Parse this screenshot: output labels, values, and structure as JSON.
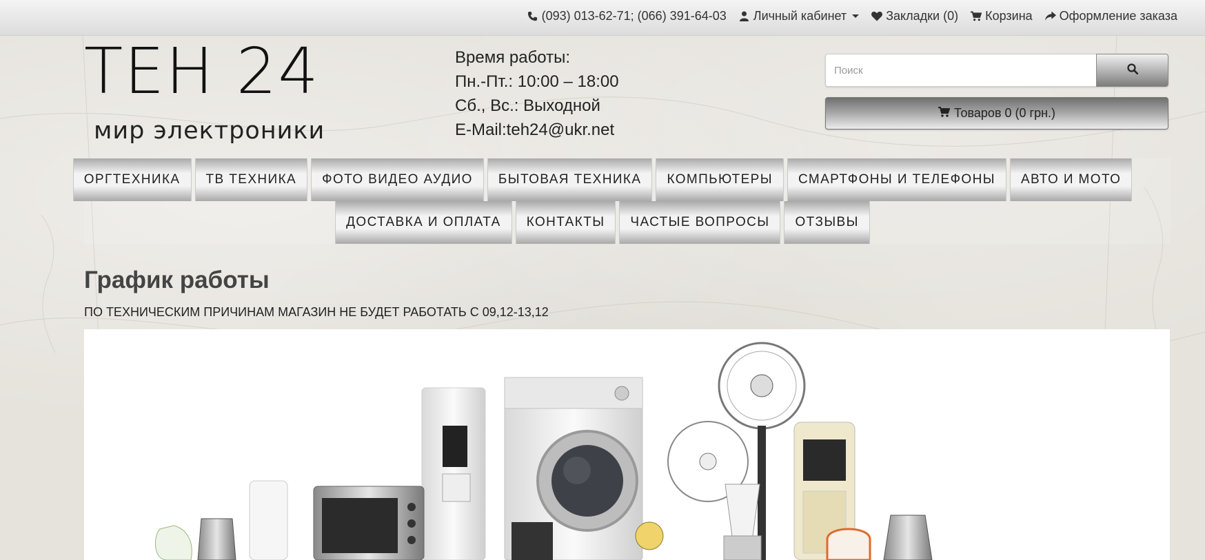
{
  "topbar": {
    "phone": "(093) 013-62-71; (066) 391-64-03",
    "account": "Личный кабинет",
    "wishlist": "Закладки (0)",
    "cart": "Корзина",
    "checkout": "Оформление заказа"
  },
  "logo": {
    "title": "ТЕН 24",
    "subtitle": "мир электроники"
  },
  "hours": {
    "line1": "Время работы:",
    "line2": "Пн.-Пт.: 10:00 – 18:00",
    "line3": "Сб., Вс.: Выходной",
    "line4": "E-Mail:teh24@ukr.net"
  },
  "search": {
    "placeholder": "Поиск"
  },
  "cart_button": {
    "label": "Товаров 0 (0 грн.)"
  },
  "menu": {
    "row1": [
      "ОРГТЕХНИКА",
      "ТВ ТЕХНИКА",
      "ФОТО ВИДЕО АУДИО",
      "БЫТОВАЯ ТЕХНИКА",
      "КОМПЬЮТЕРЫ",
      "СМАРТФОНЫ И ТЕЛЕФОНЫ",
      "АВТО И МОТО"
    ],
    "row2": [
      "ДОСТАВКА И ОПЛАТА",
      "КОНТАКТЫ",
      "ЧАСТЫЕ ВОПРОСЫ",
      "ОТЗЫВЫ"
    ]
  },
  "content": {
    "title": "График работы",
    "notice": "ПО ТЕХНИЧЕСКИМ ПРИЧИНАМ МАГАЗИН НЕ БУДЕТ РАБОТАТЬ С 09,12-13,12"
  },
  "banner": {
    "image": "home-appliances-collage"
  },
  "colors": {
    "background": "#e6e3dd",
    "topbar": "#e8e8e8",
    "text": "#333333"
  }
}
